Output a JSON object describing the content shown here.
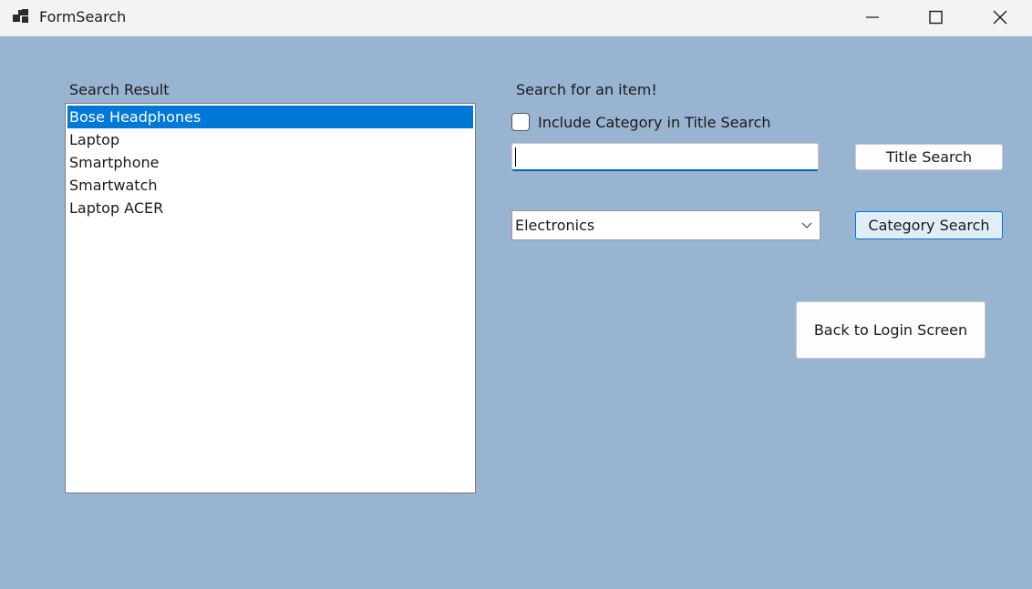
{
  "window": {
    "title": "FormSearch"
  },
  "results": {
    "label": "Search Result",
    "items": [
      "Bose Headphones",
      "Laptop",
      "Smartphone",
      "Smartwatch",
      "Laptop ACER"
    ],
    "selected_index": 0
  },
  "search": {
    "heading": "Search for an item!",
    "include_category_label": "Include Category in Title Search",
    "include_category_checked": false,
    "title_value": "",
    "title_button": "Title Search",
    "category_selected": "Electronics",
    "category_button": "Category Search"
  },
  "back_button": "Back to Login Screen",
  "colors": {
    "background": "#99b4d1",
    "selection": "#0078d7",
    "focus_border": "#0078d7"
  }
}
